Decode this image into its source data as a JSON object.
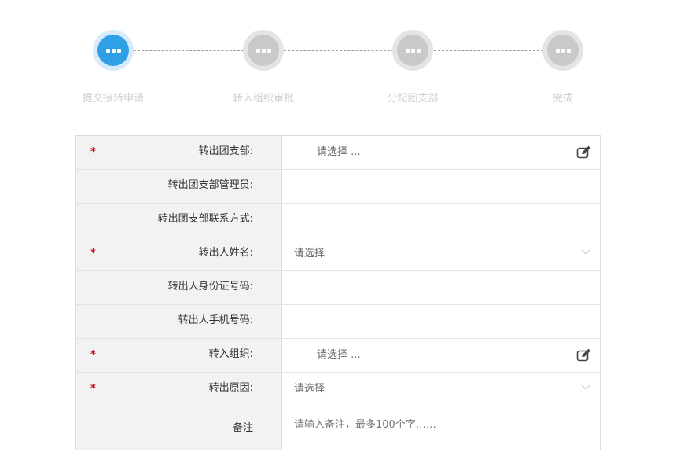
{
  "steps": [
    {
      "label": "提交接转申请",
      "state": "active"
    },
    {
      "label": "转入组织审批",
      "state": "pending"
    },
    {
      "label": "分配团支部",
      "state": "pending"
    },
    {
      "label": "完成",
      "state": "pending"
    }
  ],
  "colors": {
    "active": "#2f9fe6",
    "pending": "#c9c9c9",
    "required": "#d0021b",
    "label_bg": "#f2f2f2"
  },
  "form": {
    "rows": [
      {
        "label": "转出团支部:",
        "required": true,
        "value": "请选择 ...",
        "control": "picker",
        "icon": "edit-icon"
      },
      {
        "label": "转出团支部管理员:",
        "required": false,
        "value": "",
        "control": "text"
      },
      {
        "label": "转出团支部联系方式:",
        "required": false,
        "value": "",
        "control": "text"
      },
      {
        "label": "转出人姓名:",
        "required": true,
        "value": "请选择",
        "control": "select",
        "icon": "chevron-down-icon"
      },
      {
        "label": "转出人身份证号码:",
        "required": false,
        "value": "",
        "control": "text"
      },
      {
        "label": "转出人手机号码:",
        "required": false,
        "value": "",
        "control": "text"
      },
      {
        "label": "转入组织:",
        "required": true,
        "value": "请选择 ...",
        "control": "picker",
        "icon": "edit-icon"
      },
      {
        "label": "转出原因:",
        "required": true,
        "value": "请选择",
        "control": "select",
        "icon": "chevron-down-icon"
      }
    ],
    "remark": {
      "label": "备注",
      "placeholder": "请输入备注，最多100个字……"
    },
    "required_mark": "*"
  }
}
